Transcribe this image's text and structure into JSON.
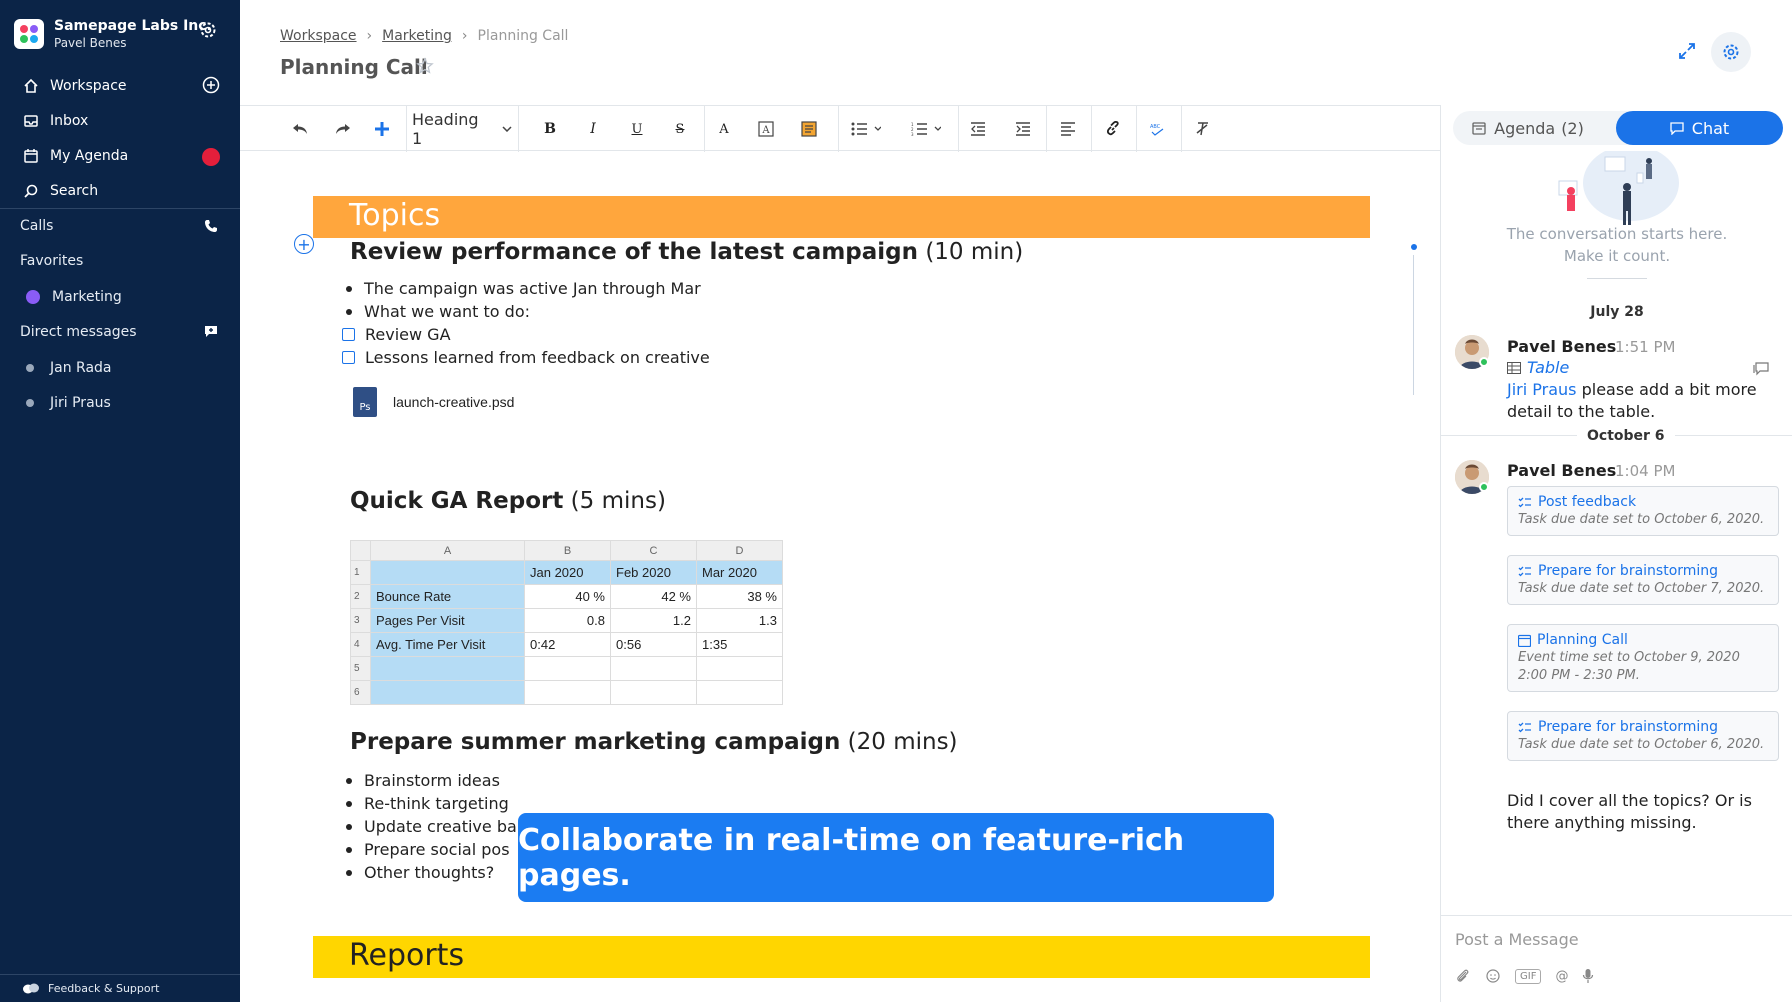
{
  "sidebar": {
    "org_name": "Samepage Labs Inc.",
    "user_name": "Pavel Benes",
    "nav": [
      {
        "label": "Workspace",
        "icon": "home-icon"
      },
      {
        "label": "Inbox",
        "icon": "inbox-icon"
      },
      {
        "label": "My Agenda",
        "icon": "calendar-icon"
      },
      {
        "label": "Search",
        "icon": "search-icon"
      }
    ],
    "calls_label": "Calls",
    "favorites_label": "Favorites",
    "favorites": [
      {
        "label": "Marketing"
      }
    ],
    "direct_messages_label": "Direct messages",
    "direct_messages": [
      {
        "label": "Jan Rada"
      },
      {
        "label": "Jiri Praus"
      }
    ],
    "feedback_label": "Feedback & Support"
  },
  "header": {
    "breadcrumb": [
      "Workspace",
      "Marketing",
      "Planning Call"
    ],
    "title": "Planning Call"
  },
  "toolbar": {
    "heading_select": "Heading 1"
  },
  "document": {
    "sections": [
      {
        "band_label": "Topics",
        "color": "#ffa63d"
      },
      {
        "band_label": "Reports",
        "color": "#ffd600"
      }
    ],
    "topic1": {
      "title": "Review performance of the latest campaign",
      "duration": "(10 min)",
      "bullets": [
        "The campaign was active Jan through Mar",
        "What we want to do:"
      ],
      "checklist": [
        "Review GA",
        "Lessons learned from feedback on creative"
      ],
      "file_name": "launch-creative.psd",
      "file_type": "Ps"
    },
    "topic2": {
      "title": "Quick GA Report",
      "duration": "(5 mins)",
      "table": {
        "col_headers": [
          "A",
          "B",
          "C",
          "D"
        ],
        "row_numbers": [
          "1",
          "2",
          "3",
          "4",
          "5",
          "6"
        ],
        "rows": [
          [
            "",
            "Jan 2020",
            "Feb 2020",
            "Mar 2020"
          ],
          [
            "Bounce Rate",
            "40 %",
            "42 %",
            "38 %"
          ],
          [
            "Pages Per Visit",
            "0.8",
            "1.2",
            "1.3"
          ],
          [
            "Avg. Time Per Visit",
            "0:42",
            "0:56",
            "1:35"
          ],
          [
            "",
            "",
            "",
            ""
          ],
          [
            "",
            "",
            "",
            ""
          ]
        ]
      }
    },
    "topic3": {
      "title": "Prepare summer marketing campaign",
      "duration": "(20 mins)",
      "bullets": [
        "Brainstorm ideas",
        "Re-think targeting",
        "Update creative ba",
        "Prepare social pos",
        "Other thoughts?"
      ]
    },
    "overlay_text": "Collaborate in real-time on feature-rich pages."
  },
  "right_panel": {
    "tabs": [
      {
        "label": "Agenda",
        "count": "(2)"
      },
      {
        "label": "Chat"
      }
    ],
    "convo_start": [
      "The conversation starts here.",
      "Make it count."
    ],
    "dates": [
      "July 28",
      "October 6"
    ],
    "messages": [
      {
        "author": "Pavel Benes",
        "time": "1:51 PM",
        "attachment": "Table",
        "mention": "Jiri Praus",
        "text_line1": " please add a bit more",
        "text_line2": "detail to the table."
      },
      {
        "author": "Pavel Benes",
        "time": "1:04 PM",
        "cards": [
          {
            "title": "Post feedback",
            "sub": "Task due date set to October 6, 2020."
          },
          {
            "title": "Prepare for brainstorming",
            "sub": "Task due date set to October 7, 2020."
          },
          {
            "title": "Planning Call",
            "sub": "Event time set to October 9, 2020 2:00 PM - 2:30 PM."
          },
          {
            "title": "Prepare for brainstorming",
            "sub": "Task due date set to October 6, 2020."
          }
        ],
        "text": "Did I cover all the topics? Or is there anything missing."
      }
    ],
    "composer_placeholder": "Post a Message",
    "gif_label": "GIF"
  }
}
